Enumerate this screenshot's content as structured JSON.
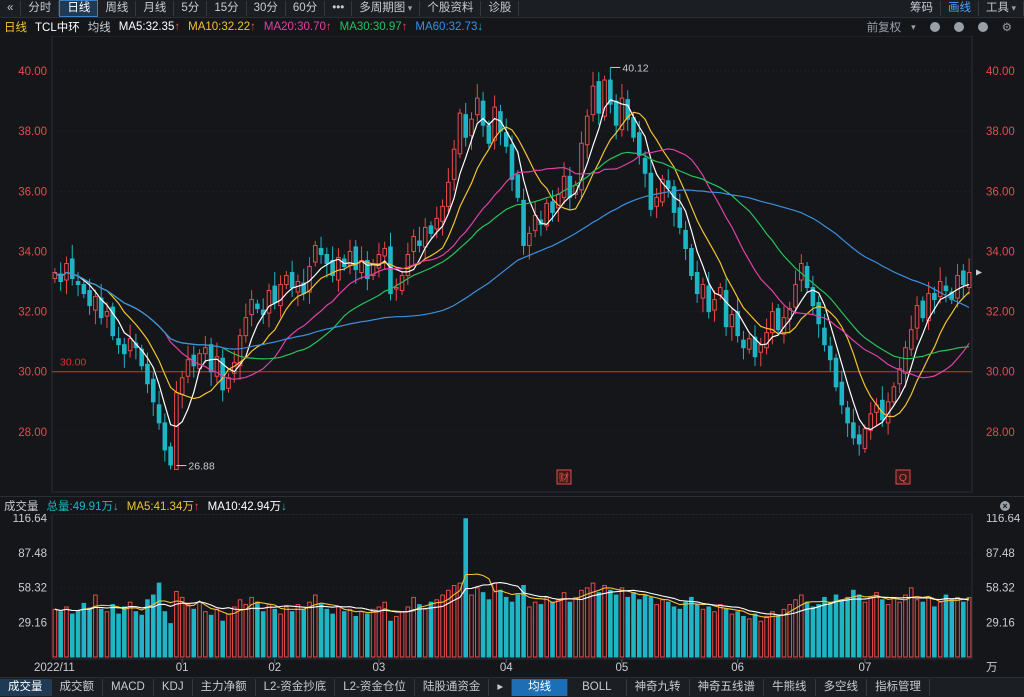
{
  "toolbar": {
    "back_glyph": "«",
    "periods": [
      "分时",
      "日线",
      "周线",
      "月线",
      "5分",
      "15分",
      "30分",
      "60分"
    ],
    "active_period": 1,
    "more_glyph": "•••",
    "multi_period": "多周期图",
    "stock_info": "个股资料",
    "diagnose": "诊股",
    "right": [
      "筹码",
      "画线",
      "工具"
    ],
    "right_active": 1
  },
  "info": {
    "period": "日线",
    "stock_name": "TCL中环",
    "ma_label": "均线",
    "ma5": "MA5:32.35",
    "ma10": "MA10:32.22",
    "ma20": "MA20:30.70",
    "ma30": "MA30:30.97",
    "ma60": "MA60:32.73",
    "fq": "前复权",
    "up_arrow": "↑",
    "down_arrow": "↓"
  },
  "volume_info": {
    "label": "成交量",
    "total": "总量:49.91万",
    "ma5": "MA5:41.34万",
    "ma10": "MA10:42.94万"
  },
  "bottom_tabs": [
    "成交量",
    "成交额",
    "MACD",
    "KDJ",
    "主力净额",
    "L2-资金抄底",
    "L2-资金仓位",
    "陆股通资金"
  ],
  "bottom_tabs2": [
    "均线",
    "BOLL",
    "神奇九转",
    "神奇五线谱",
    "牛熊线",
    "多空线",
    "指标管理"
  ],
  "colors": {
    "up": "#e84a4a",
    "down": "#1fb5c4",
    "ma5": "#ffffff",
    "ma10": "#f2c230",
    "ma20": "#e040a8",
    "ma30": "#27c25a",
    "ma60": "#3d8fe0",
    "support_line": "#e03030"
  },
  "chart_data": {
    "type": "candlestick",
    "price_axis": {
      "ticks": [
        "40.00",
        "38.00",
        "36.00",
        "34.00",
        "32.00",
        "30.00",
        "28.00"
      ],
      "ylim": [
        26.2,
        40.9
      ]
    },
    "volume_axis": {
      "ticks": [
        "116.64",
        "87.48",
        "58.32",
        "29.16"
      ],
      "ylim": [
        0,
        116.64
      ],
      "unit": "万"
    },
    "x_labels": [
      "2022/11",
      "01",
      "02",
      "03",
      "04",
      "05",
      "06",
      "07"
    ],
    "support_level": {
      "value": 30.0,
      "label": "30.00"
    },
    "annotations": {
      "high": "40.12",
      "low": "26.88",
      "marker_cai": "财",
      "marker_q": "Q"
    },
    "ma_values": {
      "ma5": 32.35,
      "ma10": 32.22,
      "ma20": 30.7,
      "ma30": 30.97,
      "ma60": 32.73
    },
    "volume_ma": {
      "total": 49.91,
      "ma5": 41.34,
      "ma10": 42.94
    },
    "close": [
      33.3,
      33.0,
      33.6,
      33.1,
      32.9,
      32.6,
      32.2,
      32.5,
      31.8,
      32.0,
      31.2,
      30.9,
      30.6,
      31.1,
      30.8,
      30.2,
      29.6,
      29.0,
      28.3,
      27.4,
      26.9,
      29.3,
      29.8,
      30.4,
      30.2,
      30.6,
      30.8,
      30.0,
      30.5,
      29.4,
      29.8,
      30.3,
      31.2,
      31.8,
      32.4,
      32.1,
      31.9,
      32.7,
      32.3,
      32.9,
      33.2,
      32.8,
      33.0,
      32.6,
      33.5,
      34.2,
      33.9,
      33.6,
      33.2,
      33.8,
      33.5,
      34.0,
      33.4,
      33.7,
      33.1,
      33.6,
      33.9,
      34.1,
      32.6,
      32.8,
      33.2,
      33.9,
      34.5,
      34.2,
      34.8,
      34.6,
      35.1,
      35.5,
      36.3,
      37.4,
      38.6,
      37.8,
      38.4,
      39.1,
      38.2,
      37.6,
      38.8,
      38.0,
      37.5,
      36.4,
      35.8,
      34.2,
      34.6,
      35.2,
      34.9,
      35.6,
      35.3,
      35.9,
      36.5,
      35.8,
      36.2,
      37.6,
      38.5,
      39.5,
      38.6,
      39.7,
      38.9,
      38.2,
      39.1,
      38.4,
      37.8,
      37.2,
      36.6,
      35.4,
      35.8,
      36.4,
      36.1,
      35.3,
      34.8,
      34.1,
      33.2,
      32.6,
      32.9,
      32.0,
      32.4,
      32.8,
      31.5,
      31.9,
      31.2,
      30.8,
      31.1,
      30.5,
      30.9,
      31.3,
      32.0,
      31.4,
      31.8,
      32.1,
      32.9,
      33.6,
      32.8,
      32.2,
      31.6,
      30.9,
      30.4,
      29.5,
      28.9,
      28.3,
      27.8,
      27.6,
      28.1,
      28.6,
      28.9,
      28.4,
      29.0,
      29.5,
      30.1,
      30.8,
      31.4,
      32.2,
      31.8,
      32.6,
      32.4,
      33.0,
      32.7,
      32.4,
      33.2,
      32.9,
      33.3
    ],
    "volume": [
      40,
      38,
      42,
      36,
      39,
      45,
      41,
      52,
      40,
      38,
      44,
      36,
      42,
      46,
      38,
      35,
      48,
      52,
      62,
      38,
      28,
      55,
      50,
      44,
      40,
      46,
      38,
      35,
      40,
      30,
      36,
      42,
      48,
      44,
      50,
      46,
      38,
      44,
      40,
      36,
      42,
      38,
      44,
      40,
      46,
      52,
      44,
      40,
      36,
      42,
      38,
      40,
      34,
      38,
      36,
      40,
      42,
      46,
      30,
      34,
      38,
      42,
      50,
      44,
      40,
      46,
      48,
      52,
      56,
      60,
      62,
      116,
      52,
      58,
      54,
      48,
      62,
      56,
      50,
      46,
      52,
      60,
      42,
      46,
      44,
      50,
      46,
      48,
      54,
      46,
      50,
      56,
      58,
      62,
      54,
      60,
      56,
      52,
      58,
      50,
      54,
      48,
      52,
      50,
      44,
      48,
      46,
      42,
      40,
      46,
      50,
      44,
      40,
      42,
      38,
      44,
      40,
      36,
      38,
      34,
      32,
      36,
      30,
      34,
      38,
      34,
      40,
      44,
      48,
      52,
      46,
      42,
      44,
      50,
      46,
      52,
      48,
      50,
      56,
      52,
      46,
      50,
      54,
      48,
      44,
      50,
      46,
      52,
      58,
      48,
      46,
      50,
      42,
      46,
      52,
      48,
      50,
      46,
      50
    ]
  }
}
